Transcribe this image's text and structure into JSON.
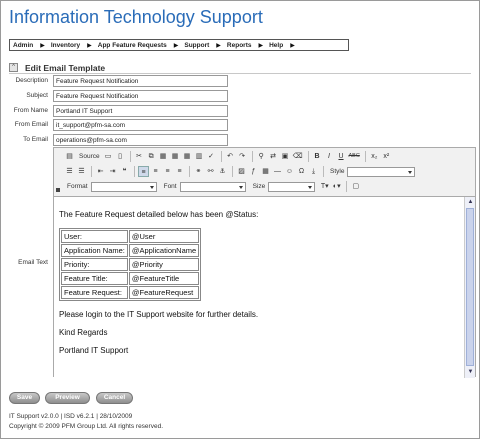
{
  "app_title": "Information Technology Support",
  "nav": [
    "Admin",
    "Inventory",
    "App Feature Requests",
    "Support",
    "Reports",
    "Help"
  ],
  "section_title": "Edit Email Template",
  "form": {
    "description_label": "Description",
    "description_value": "Feature Request Notification",
    "subject_label": "Subject",
    "subject_value": "Feature Request Notification",
    "from_name_label": "From Name",
    "from_name_value": "Portland IT Support",
    "from_email_label": "From Email",
    "from_email_value": "it_support@pfm-sa.com",
    "to_email_label": "To Email",
    "to_email_value": "operations@pfm-sa.com",
    "email_text_label": "Email Text"
  },
  "toolbar": {
    "source_label": "Source",
    "format_label": "Format",
    "font_label": "Font",
    "size_label": "Size",
    "style_label": "Style"
  },
  "email_body": {
    "intro": "The Feature Request detailed below has been @Status:",
    "rows": [
      {
        "label": "User:",
        "value": "@User"
      },
      {
        "label": "Application Name:",
        "value": "@ApplicationName"
      },
      {
        "label": "Priority:",
        "value": "@Priority"
      },
      {
        "label": "Feature Title:",
        "value": "@FeatureTitle"
      },
      {
        "label": "Feature Request:",
        "value": "@FeatureRequest"
      }
    ],
    "login_text": "Please login to the IT Support website for further details.",
    "regards": "Kind Regards",
    "signature": "Portland IT Support"
  },
  "buttons": {
    "save": "Save",
    "preview": "Preview",
    "cancel": "Cancel"
  },
  "footer": {
    "version": "IT Support v2.0.0 | ISD v6.2.1 | 28/10/2009",
    "copyright": "Copyright © 2009 PFM Group Ltd. All rights reserved."
  },
  "colors": {
    "title": "#2a6cb8",
    "button": "#a8a8a8"
  }
}
